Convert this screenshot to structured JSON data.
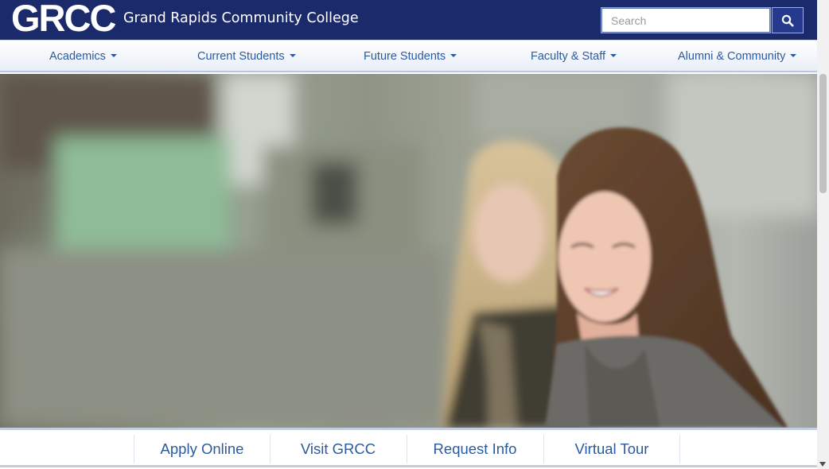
{
  "header": {
    "logo_text": "GRCC",
    "college_name": "Grand Rapids Community College",
    "search": {
      "placeholder": "Search",
      "value": ""
    },
    "search_icon": "magnifier-icon",
    "brand_color": "#1b2a6b"
  },
  "nav": {
    "items": [
      {
        "label": "Academics"
      },
      {
        "label": "Current Students"
      },
      {
        "label": "Future Students"
      },
      {
        "label": "Faculty & Staff"
      },
      {
        "label": "Alumni & Community"
      }
    ],
    "link_color": "#2a5ba0"
  },
  "hero": {
    "image_description_icon": "photo-two-students-smiling"
  },
  "quick_links": [
    {
      "label": "Apply Online"
    },
    {
      "label": "Visit GRCC"
    },
    {
      "label": "Request Info"
    },
    {
      "label": "Virtual Tour"
    }
  ]
}
